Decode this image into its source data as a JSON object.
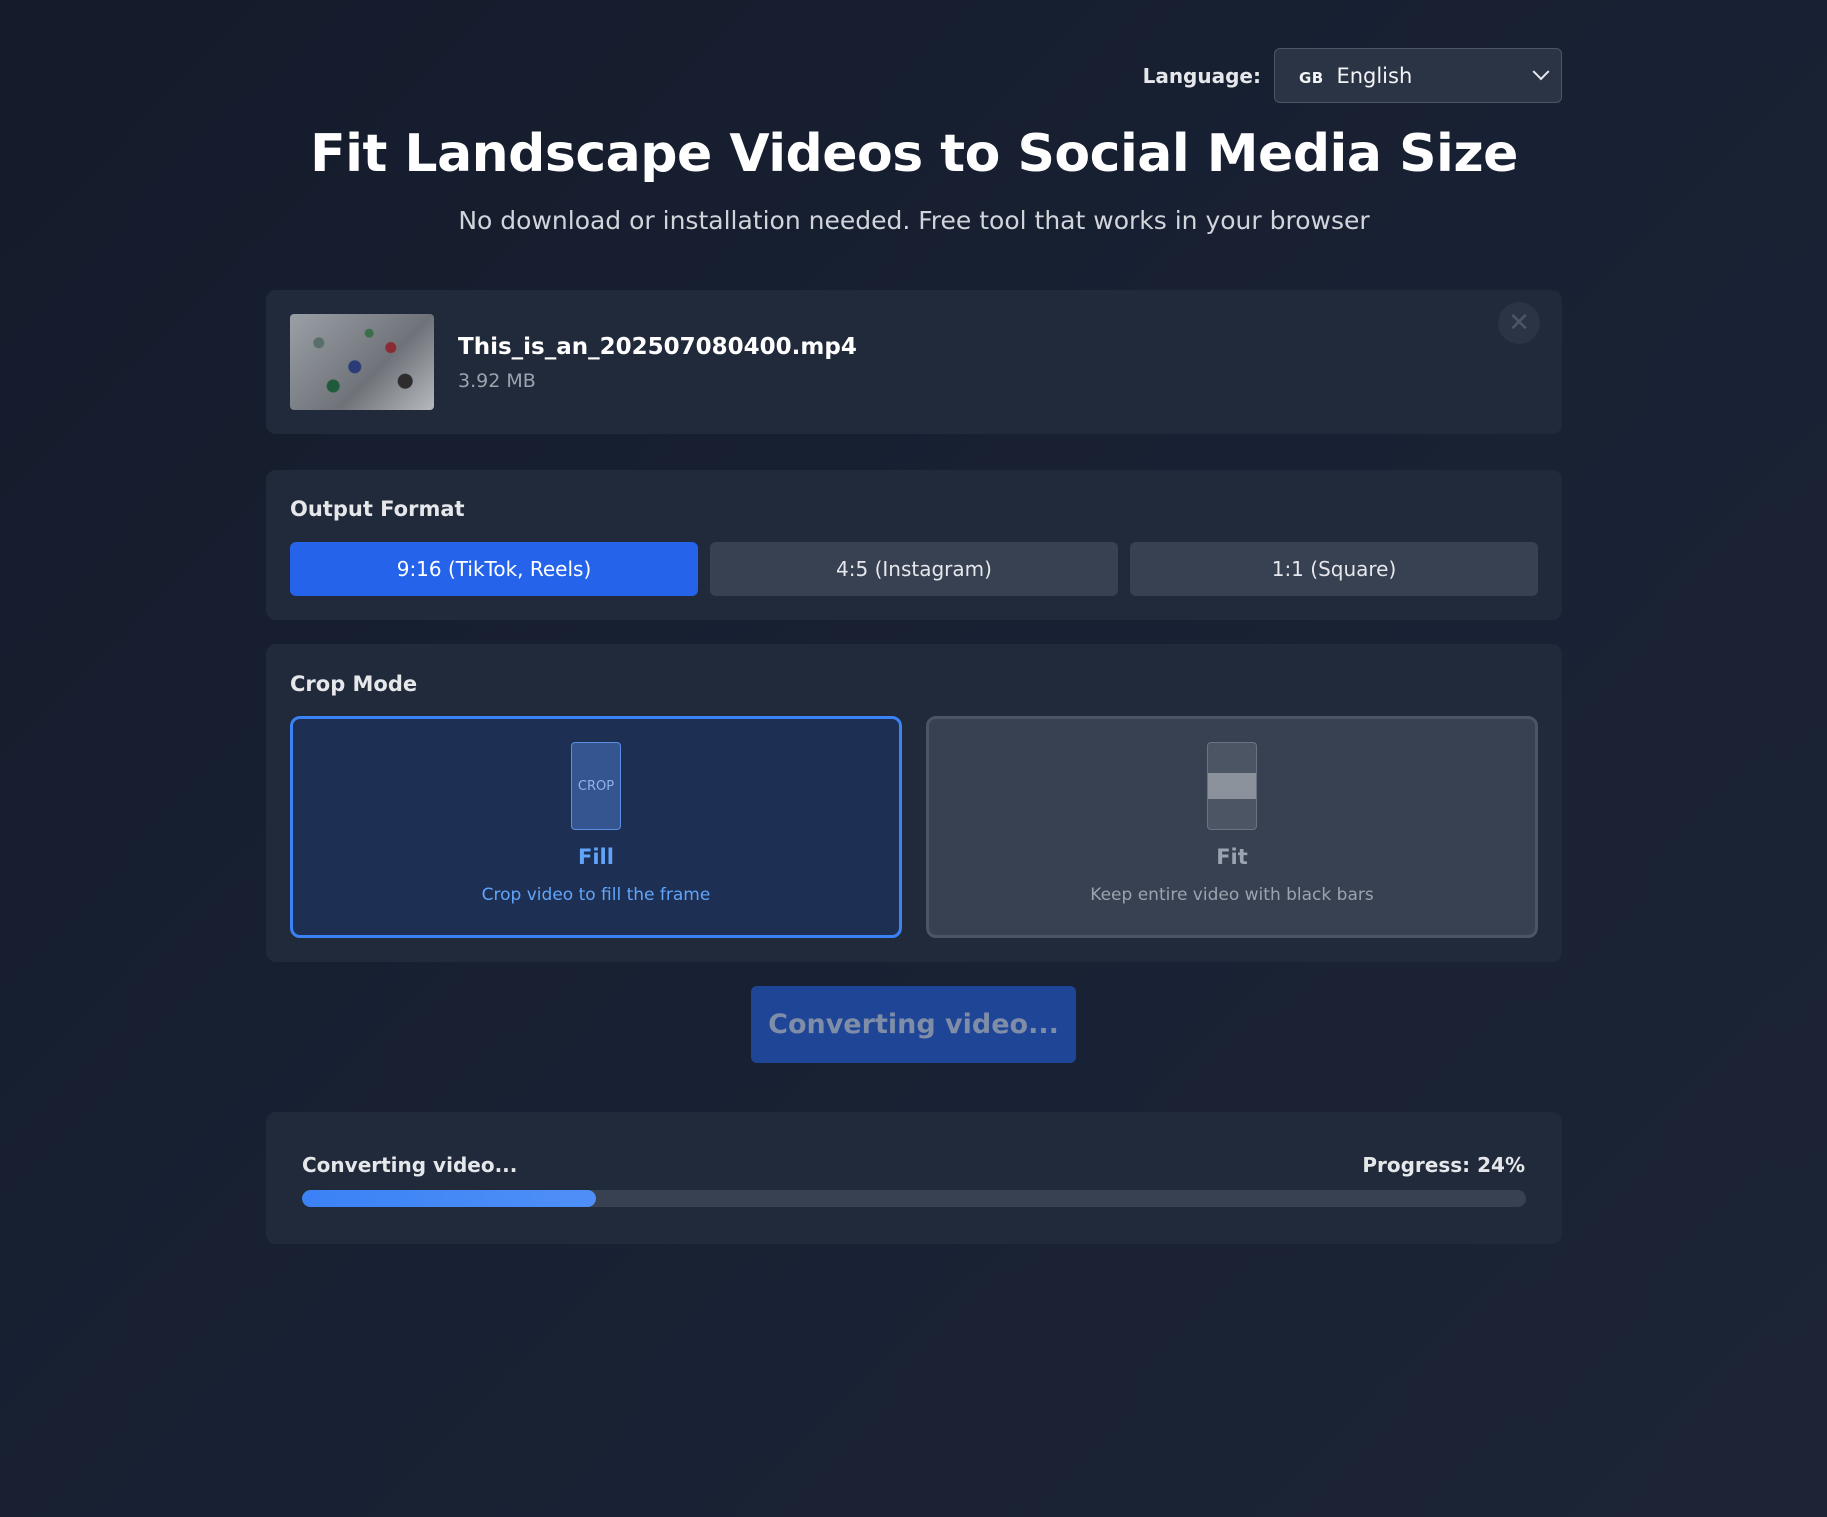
{
  "language": {
    "label": "Language:",
    "flag": "GB",
    "selected": "English"
  },
  "header": {
    "title": "Fit Landscape Videos to Social Media Size",
    "subtitle": "No download or installation needed. Free tool that works in your browser"
  },
  "file": {
    "name": "This_is_an_202507080400.mp4",
    "size": "3.92 MB",
    "remove_icon": "close-icon"
  },
  "output_format": {
    "title": "Output Format",
    "options": [
      {
        "label": "9:16 (TikTok, Reels)",
        "active": true
      },
      {
        "label": "4:5 (Instagram)",
        "active": false
      },
      {
        "label": "1:1 (Square)",
        "active": false
      }
    ]
  },
  "crop_mode": {
    "title": "Crop Mode",
    "fill": {
      "icon_text": "CROP",
      "name": "Fill",
      "description": "Crop video to fill the frame",
      "active": true
    },
    "fit": {
      "name": "Fit",
      "description": "Keep entire video with black bars",
      "active": false
    }
  },
  "convert_button": {
    "label": "Converting video..."
  },
  "progress": {
    "status": "Converting video...",
    "label": "Progress: 24%",
    "percent": 24
  },
  "colors": {
    "accent": "#2563eb",
    "background": "#182133",
    "card": "#212a3a"
  }
}
